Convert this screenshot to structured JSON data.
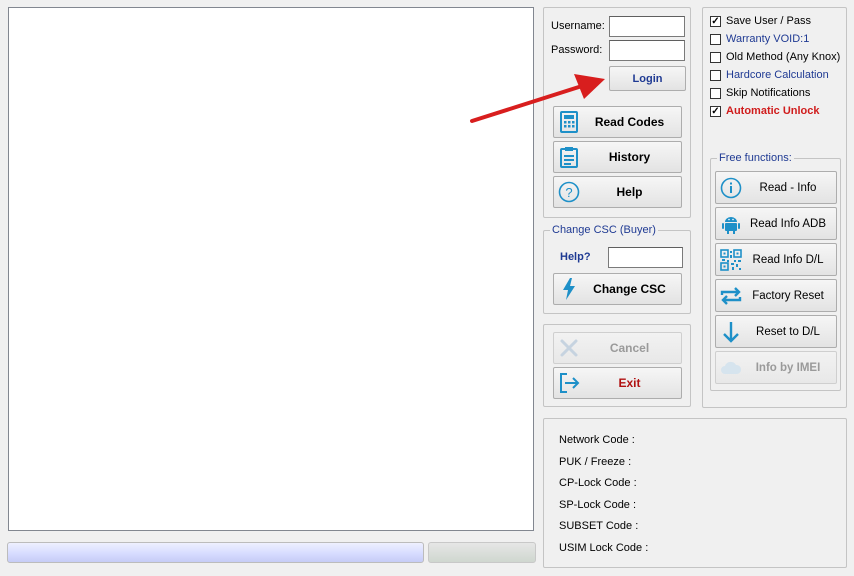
{
  "login": {
    "username_label": "Username:",
    "username_value": "",
    "password_label": "Password:",
    "password_value": "",
    "login_button": "Login"
  },
  "main_buttons": {
    "read_codes": "Read Codes",
    "history": "History",
    "help": "Help"
  },
  "change_csc": {
    "legend": "Change CSC (Buyer)",
    "help_link": "Help?",
    "input_value": "",
    "button": "Change CSC"
  },
  "actions": {
    "cancel": "Cancel",
    "exit": "Exit"
  },
  "options": [
    {
      "label": "Save User / Pass",
      "checked": true,
      "color": "#000000",
      "bold": false
    },
    {
      "label": "Warranty VOID:1",
      "checked": false,
      "color": "#1f3a93",
      "bold": false
    },
    {
      "label": "Old Method (Any Knox)",
      "checked": false,
      "color": "#000000",
      "bold": false
    },
    {
      "label": "Hardcore Calculation",
      "checked": false,
      "color": "#1f3a93",
      "bold": false
    },
    {
      "label": "Skip Notifications",
      "checked": false,
      "color": "#000000",
      "bold": false
    },
    {
      "label": "Automatic Unlock",
      "checked": true,
      "color": "#d01c1c",
      "bold": true
    }
  ],
  "free_functions": {
    "legend": "Free functions:",
    "read_info": "Read - Info",
    "read_info_adb": "Read Info ADB",
    "read_info_dl": "Read Info D/L",
    "factory_reset": "Factory Reset",
    "reset_to_dl": "Reset to D/L",
    "info_by_imei": "Info by IMEI"
  },
  "codes": {
    "network": "Network Code :",
    "puk": "PUK / Freeze :",
    "cp_lock": "CP-Lock Code :",
    "sp_lock": "SP-Lock Code :",
    "subset": "SUBSET Code :",
    "usim_lock": "USIM Lock Code :"
  },
  "colors": {
    "accent_blue": "#1f3a93",
    "exit_red": "#b01010",
    "arrow_red": "#d81e1e",
    "icon_blue": "#1e90c8"
  }
}
